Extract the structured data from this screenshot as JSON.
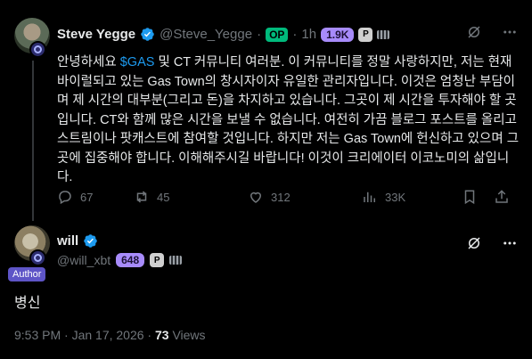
{
  "tweet": {
    "author_name": "Steve Yegge",
    "author_handle": "@Steve_Yegge",
    "handle_separator": "·",
    "op_label": "OP",
    "time_separator": "·",
    "time": "1h",
    "follower_badge": "1.9K",
    "p_chip": "P",
    "text_before_cashtag": "안녕하세요 ",
    "cashtag": "$GAS",
    "text_after_cashtag": " 및 CT 커뮤니티 여러분. 이 커뮤니티를 정말 사랑하지만, 저는 현재 바이럴되고 있는 Gas Town의 창시자이자 유일한 관리자입니다. 이것은 엄청난 부담이며 제 시간의 대부분(그리고 돈)을 차지하고 있습니다. 그곳이 제 시간을 투자해야 할 곳입니다. CT와 함께 많은 시간을 보낼 수 없습니다. 여전히 가끔 블로그 포스트를 올리고 스트림이나 팟캐스트에 참여할 것입니다. 하지만 저는 Gas Town에 헌신하고 있으며 그곳에 집중해야 합니다. 이해해주시길 바랍니다! 이것이 크리에이터 이코노미의 삶입니다.",
    "replies": "67",
    "reposts": "45",
    "likes": "312",
    "views": "33K"
  },
  "reply": {
    "author_name": "will",
    "author_handle": "@will_xbt",
    "follower_badge": "648",
    "p_chip": "P",
    "author_tag": "Author",
    "text": "병신",
    "timestamp": "9:53 PM · Jan 17, 2026 · ",
    "views_count": "73",
    "views_label": " Views"
  },
  "icons": [
    "verified-icon",
    "rank-strip-icon",
    "hide-icon",
    "more-icon",
    "reply-icon",
    "repost-icon",
    "like-icon",
    "views-icon",
    "bookmark-icon",
    "share-icon"
  ],
  "colors": {
    "background": "#000000",
    "accent": "#1d9bf0",
    "op": "#00ba7c",
    "count_badge": "#a78bfa",
    "author_tag": "#5e55c7"
  }
}
